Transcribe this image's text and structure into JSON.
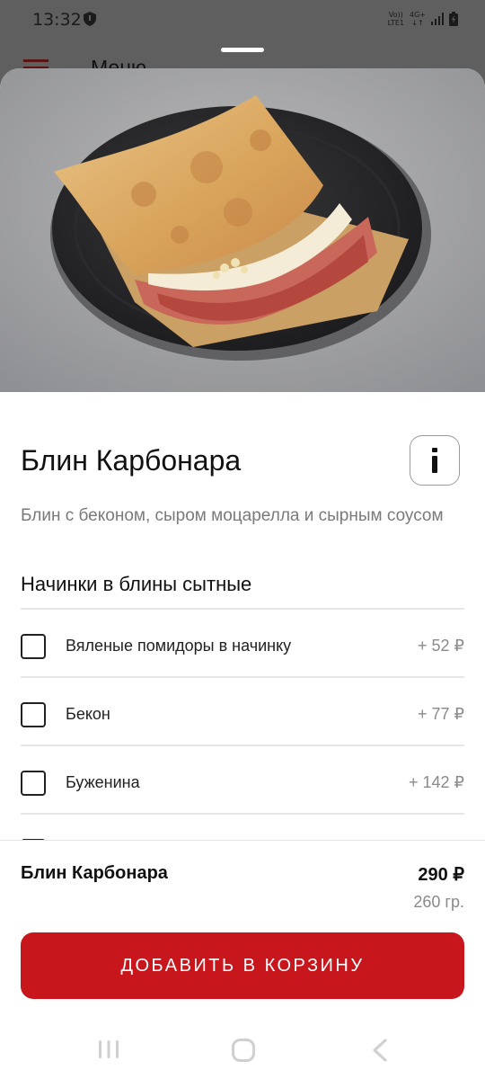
{
  "status_bar": {
    "time": "13:32",
    "network_top": "Vo))",
    "network_bottom": "LTE1",
    "data_label": "4G+"
  },
  "background_page": {
    "title": "Меню"
  },
  "product": {
    "title": "Блин Карбонара",
    "description": "Блин с беконом, сыром моцарелла и сырным соусом",
    "image_icon": "crepe-photo"
  },
  "toppings": {
    "section_title": "Начинки в блины сытные",
    "items": [
      {
        "name": "Вяленые помидоры в начинку",
        "price": "+ 52 ₽",
        "checked": false
      },
      {
        "name": "Бекон",
        "price": "+ 77 ₽",
        "checked": false
      },
      {
        "name": "Буженина",
        "price": "+ 142 ₽",
        "checked": false
      }
    ]
  },
  "summary": {
    "name": "Блин Карбонара",
    "price": "290 ₽",
    "weight": "260 гр.",
    "add_button_label": "ДОБАВИТЬ В КОРЗИНУ"
  },
  "colors": {
    "accent": "#c8161d",
    "scrim": "#5f5f5f"
  }
}
